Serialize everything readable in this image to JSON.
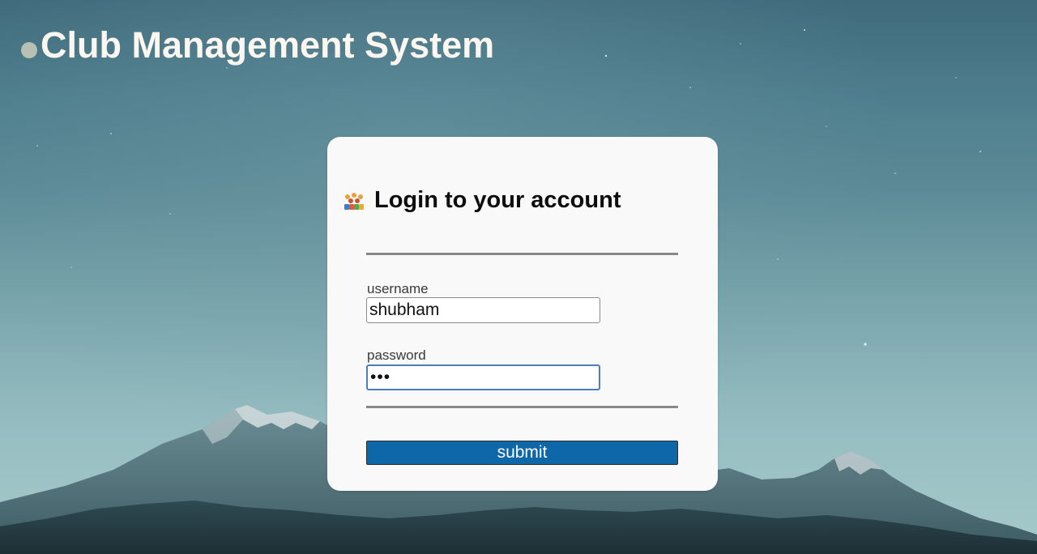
{
  "header": {
    "title": "Club Management System"
  },
  "login": {
    "heading": "Login to your account",
    "username_label": "username",
    "username_value": "shubham",
    "password_label": "password",
    "password_value": "abc",
    "submit_label": "submit",
    "header_icon": "club-members-icon"
  },
  "colors": {
    "title_text": "#fbf7f0",
    "card_background": "#f9f9fa",
    "submit_background": "#0d67a8",
    "focus_border": "#4a7fbf"
  }
}
